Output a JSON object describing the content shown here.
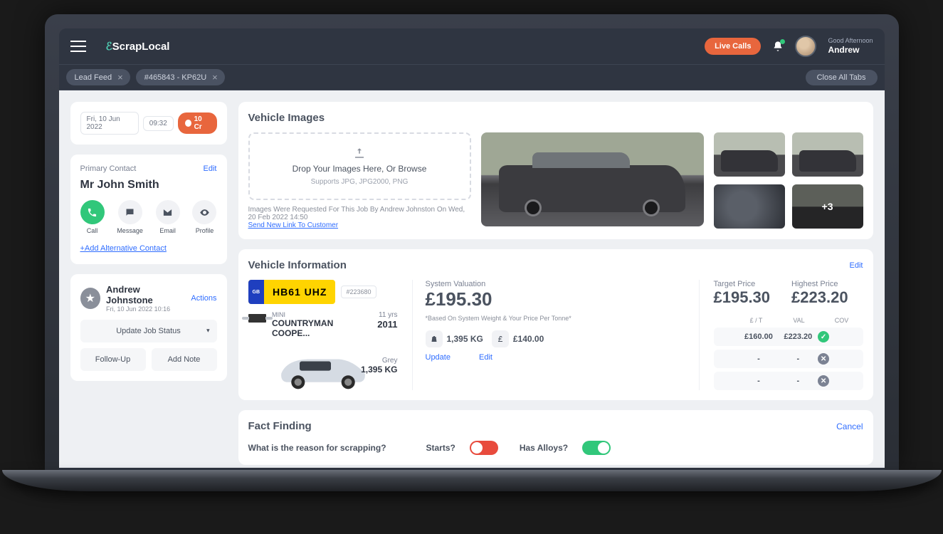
{
  "header": {
    "logo_main": "ScrapLocal",
    "live_calls": "Live Calls",
    "greeting": "Good Afternoon",
    "username": "Andrew"
  },
  "tabs": {
    "lead_feed": "Lead Feed",
    "job_tab": "#465843 - KP62U",
    "close_all": "Close All Tabs"
  },
  "meta": {
    "date": "Fri, 10 Jun 2022",
    "time": "09:32",
    "credit": "10 Cr"
  },
  "contact": {
    "section": "Primary Contact",
    "edit": "Edit",
    "name": "Mr John Smith",
    "call": "Call",
    "message": "Message",
    "email": "Email",
    "profile": "Profile",
    "add_alt": "+Add Alternative Contact"
  },
  "job": {
    "agent": "Andrew Johnstone",
    "timestamp": "Fri, 10 Jun 2022 10:16",
    "actions": "Actions",
    "update_status": "Update Job Status",
    "follow_up": "Follow-Up",
    "add_note": "Add Note"
  },
  "images": {
    "title": "Vehicle Images",
    "drop_text": "Drop Your Images Here, Or Browse",
    "drop_sub": "Supports JPG, JPG2000, PNG",
    "note": "Images Were Requested For This Job By Andrew Johnston On Wed, 20 Feb 2022 14:50",
    "send_link": "Send New Link To Customer",
    "more": "+3"
  },
  "vehicle": {
    "title": "Vehicle Information",
    "edit": "Edit",
    "plate": "HB61 UHZ",
    "gb": "GB",
    "ref": "#223680",
    "make": "MINI",
    "model": "COUNTRYMAN COOPE...",
    "age": "11 yrs",
    "year": "2011",
    "colour": "Grey",
    "weight": "1,395 KG"
  },
  "valuation": {
    "sys_label": "System Valuation",
    "sys_value": "£195.30",
    "note": "*Based On System Weight & Your Price Per Tonne*",
    "weight": "1,395 KG",
    "ppt": "£140.00",
    "update": "Update",
    "edit": "Edit",
    "target_label": "Target Price",
    "target_value": "£195.30",
    "highest_label": "Highest Price",
    "highest_value": "£223.20",
    "col_et": "£ / T",
    "col_val": "VAL",
    "col_cov": "COV",
    "row1_et": "£160.00",
    "row1_val": "£223.20"
  },
  "fact": {
    "title": "Fact Finding",
    "cancel": "Cancel",
    "q_reason": "What is the reason for scrapping?",
    "q_starts": "Starts?",
    "q_alloys": "Has Alloys?"
  }
}
